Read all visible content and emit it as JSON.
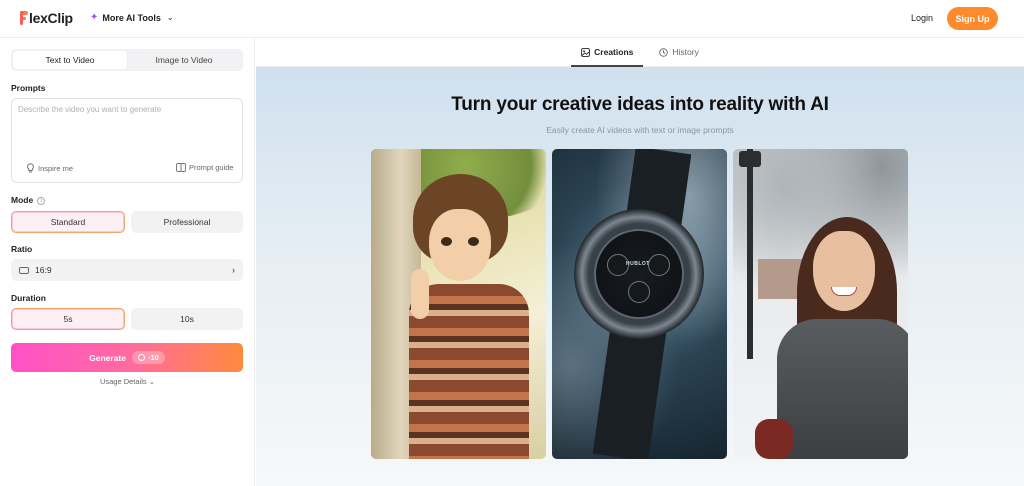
{
  "header": {
    "logo_text": "lexClip",
    "ai_tools_label": "More AI Tools",
    "login_label": "Login",
    "signup_label": "Sign Up"
  },
  "left_panel": {
    "tabs": [
      "Text to Video",
      "Image to Video"
    ],
    "active_tab": "Text to Video",
    "prompts_label": "Prompts",
    "prompt_placeholder": "Describe the video you want to generate",
    "prompt_value": "",
    "inspire_label": "Inspire me",
    "guide_label": "Prompt guide",
    "mode_label": "Mode",
    "mode_options": [
      "Standard",
      "Professional"
    ],
    "mode_selected": "Standard",
    "ratio_label": "Ratio",
    "ratio_value": "16:9",
    "duration_label": "Duration",
    "duration_options": [
      "5s",
      "10s"
    ],
    "duration_selected": "5s",
    "generate_label": "Generate",
    "generate_cost": "-10",
    "usage_label": "Usage Details"
  },
  "main": {
    "tabs": [
      "Creations",
      "History"
    ],
    "active_tab": "Creations",
    "hero_title": "Turn your creative ideas into reality with AI",
    "hero_subtitle": "Easily create AI videos with text or image prompts",
    "watch_brand": "HUBLOT"
  },
  "colors": {
    "accent_orange": "#ff8a2b",
    "generate_gradient_start": "#ff50c8",
    "generate_gradient_end": "#ff8a3d",
    "ai_sparkle": "#a84cf5"
  }
}
